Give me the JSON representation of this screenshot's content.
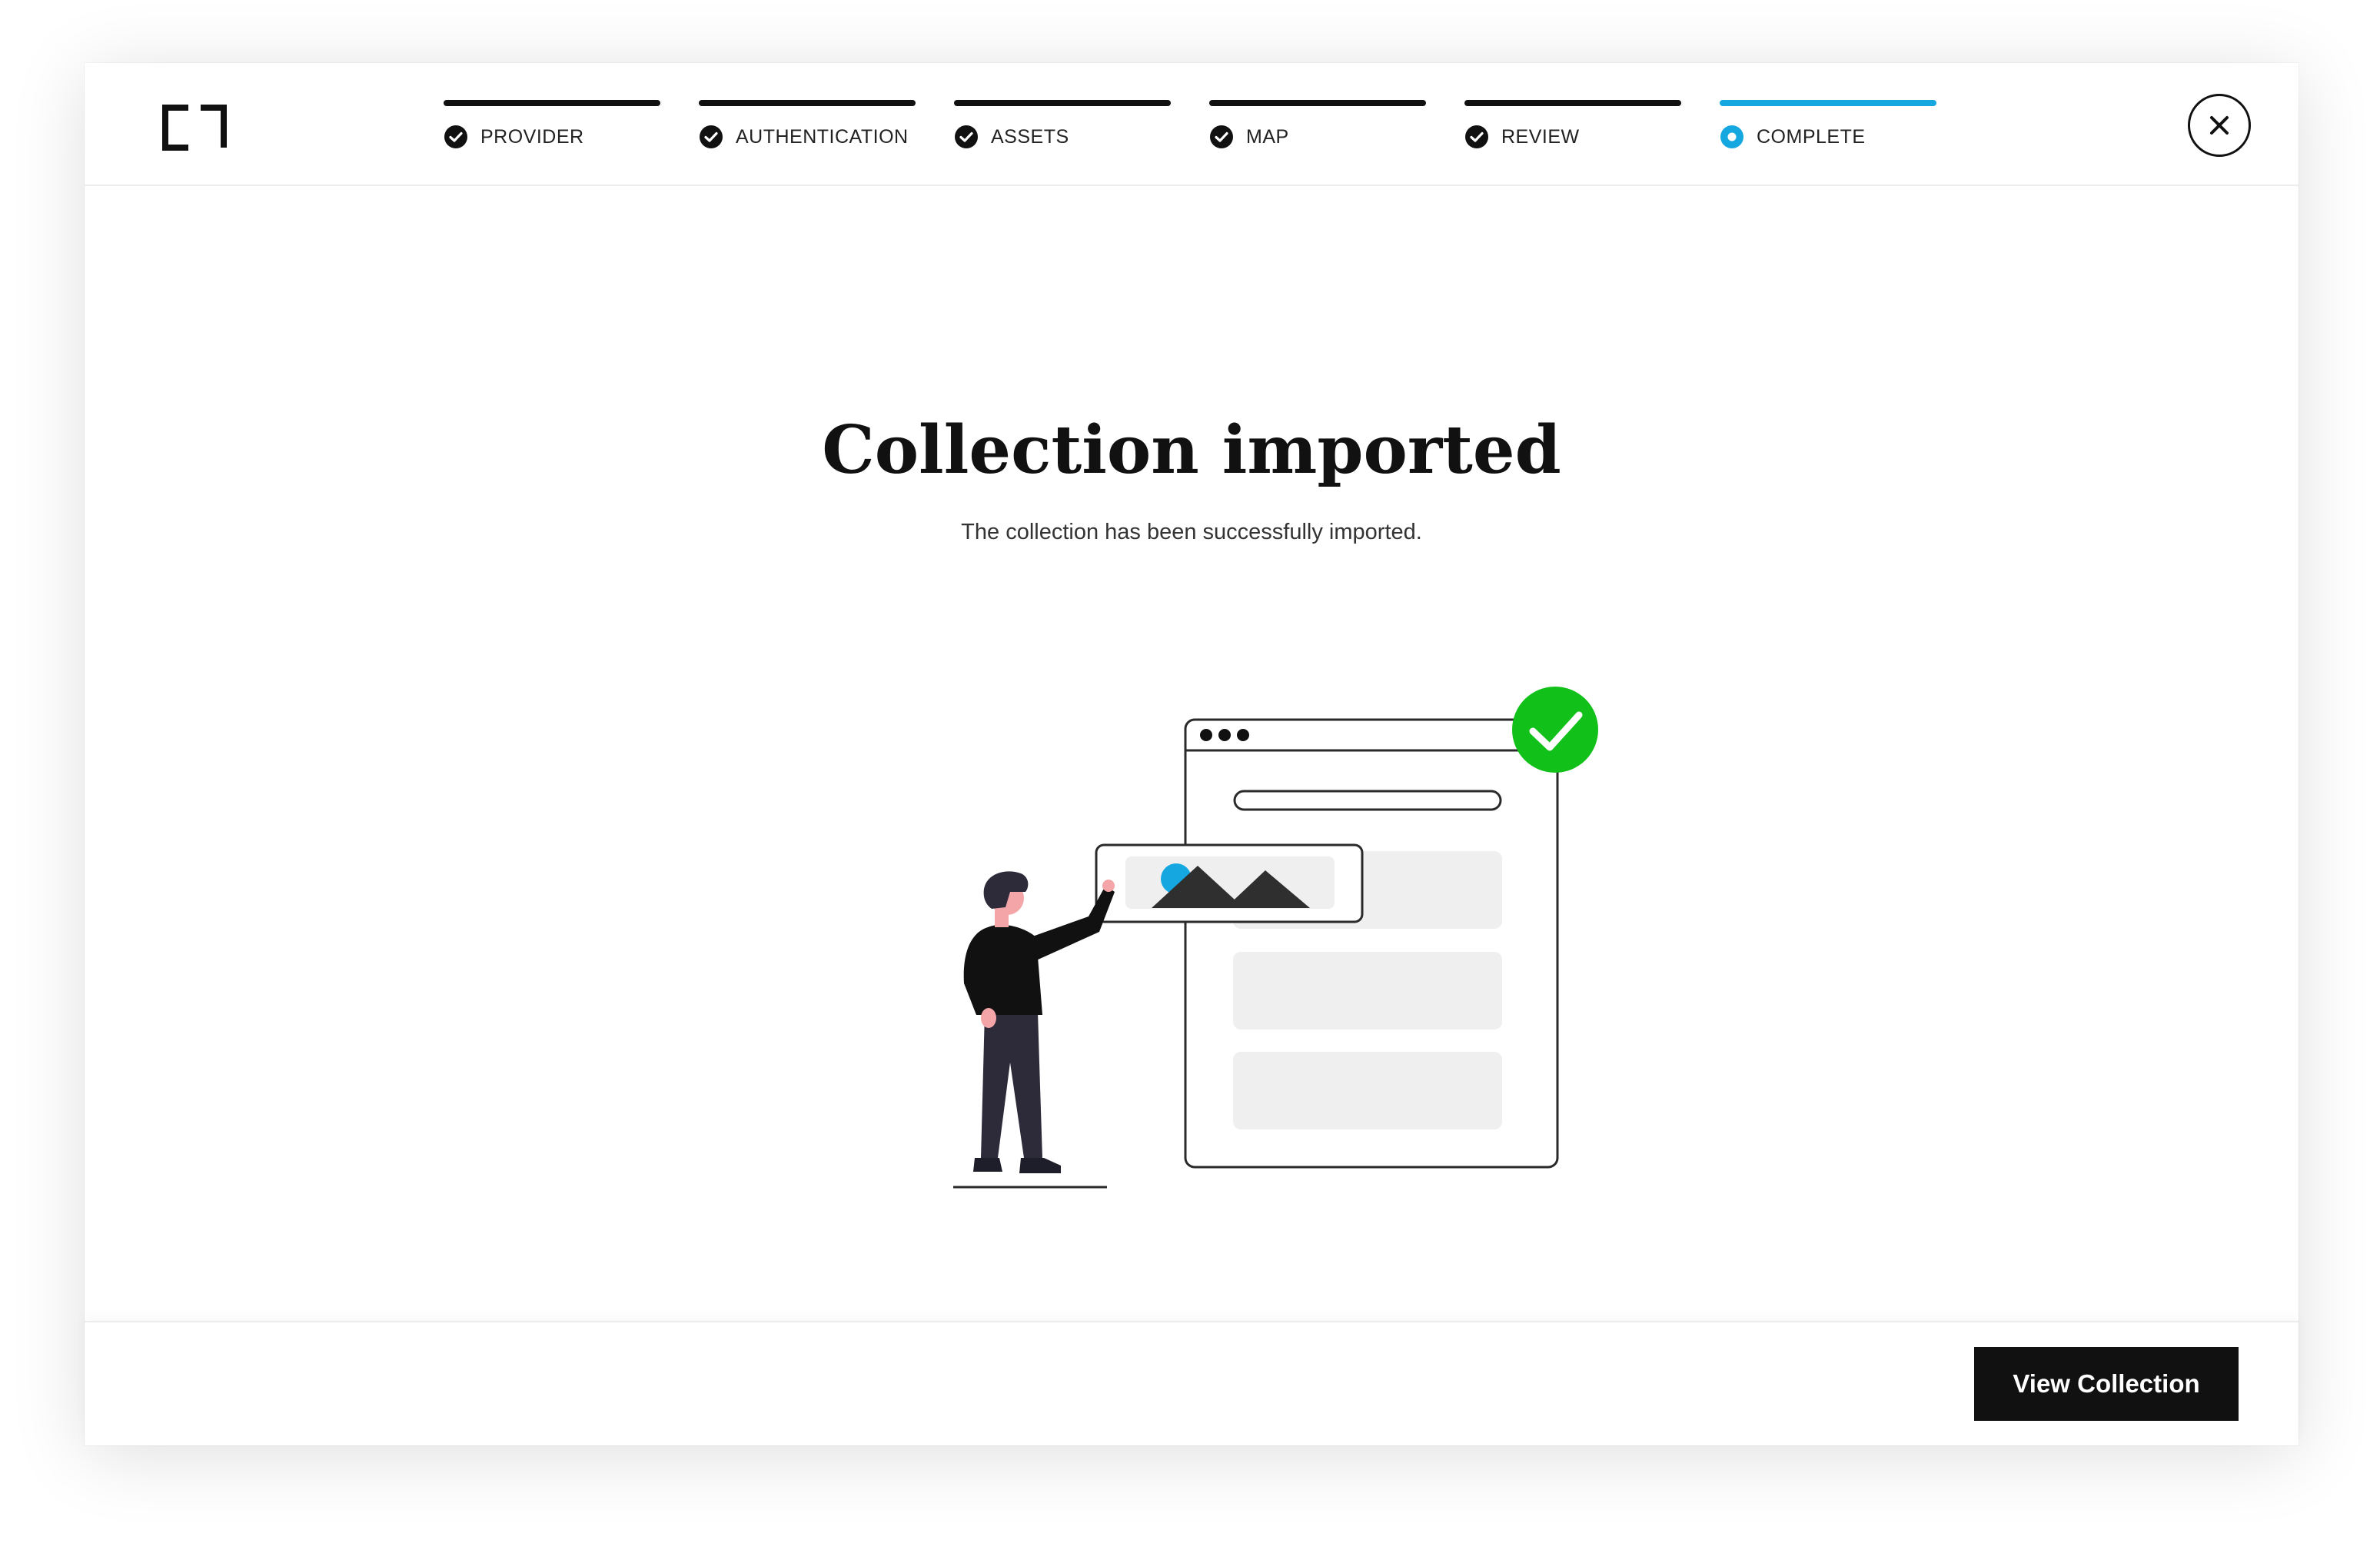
{
  "wizard": {
    "steps": [
      {
        "label": "PROVIDER",
        "status": "done"
      },
      {
        "label": "AUTHENTICATION",
        "status": "done"
      },
      {
        "label": "ASSETS",
        "status": "done"
      },
      {
        "label": "MAP",
        "status": "done"
      },
      {
        "label": "REVIEW",
        "status": "done"
      },
      {
        "label": "COMPLETE",
        "status": "active"
      }
    ]
  },
  "colors": {
    "accent": "#15a8e0",
    "success": "#12c01a",
    "dark": "#111111",
    "placeholder": "#efefef"
  },
  "icons": {
    "logo": "bracket-logo",
    "close": "close-icon",
    "step_done": "check-circle-icon",
    "step_active": "radio-dot-icon",
    "success": "checkmark-badge-icon"
  },
  "content": {
    "title": "Collection imported",
    "subtitle": "The collection has been successfully imported."
  },
  "footer": {
    "primary_label": "View Collection"
  }
}
